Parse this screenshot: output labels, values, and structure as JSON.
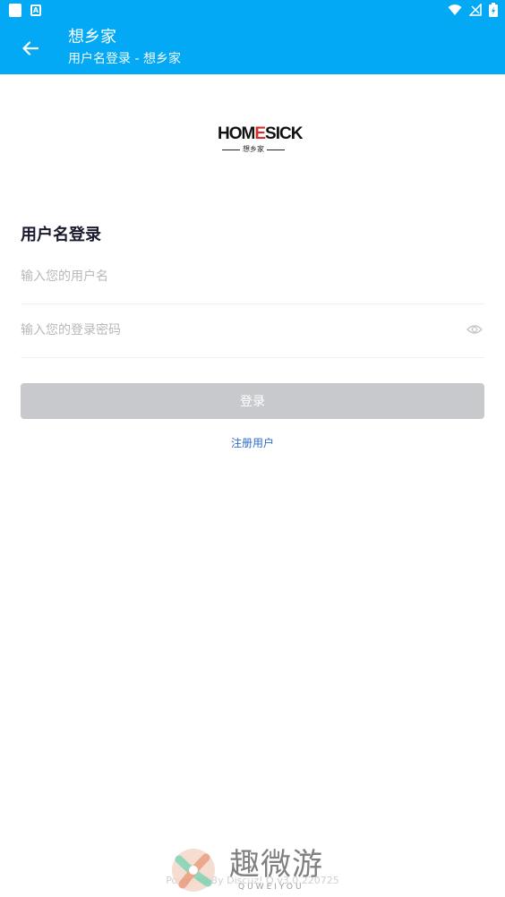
{
  "colors": {
    "primary": "#03a9f4",
    "button_disabled": "#c8c9cc",
    "link": "#2f6cc9",
    "logo_accent": "#d32f2f"
  },
  "app_bar": {
    "title": "想乡家",
    "subtitle": "用户名登录 - 想乡家"
  },
  "logo": {
    "word_start": "HOM",
    "word_accent": "E",
    "word_end": "SICK",
    "subtitle": "想乡家"
  },
  "form": {
    "heading": "用户名登录",
    "username_placeholder": "输入您的用户名",
    "password_placeholder": "输入您的登录密码",
    "login_label": "登录",
    "register_label": "注册用户"
  },
  "footer": {
    "powered_by": "Powered By Discuz! Q v3.0.220725"
  },
  "watermark": {
    "text": "趣微游",
    "sub": "QUWEIYOU"
  },
  "icons": {
    "back": "arrow-left-icon",
    "eye": "eye-icon",
    "wifi": "wifi-icon",
    "signal": "signal-icon",
    "battery": "battery-icon"
  }
}
